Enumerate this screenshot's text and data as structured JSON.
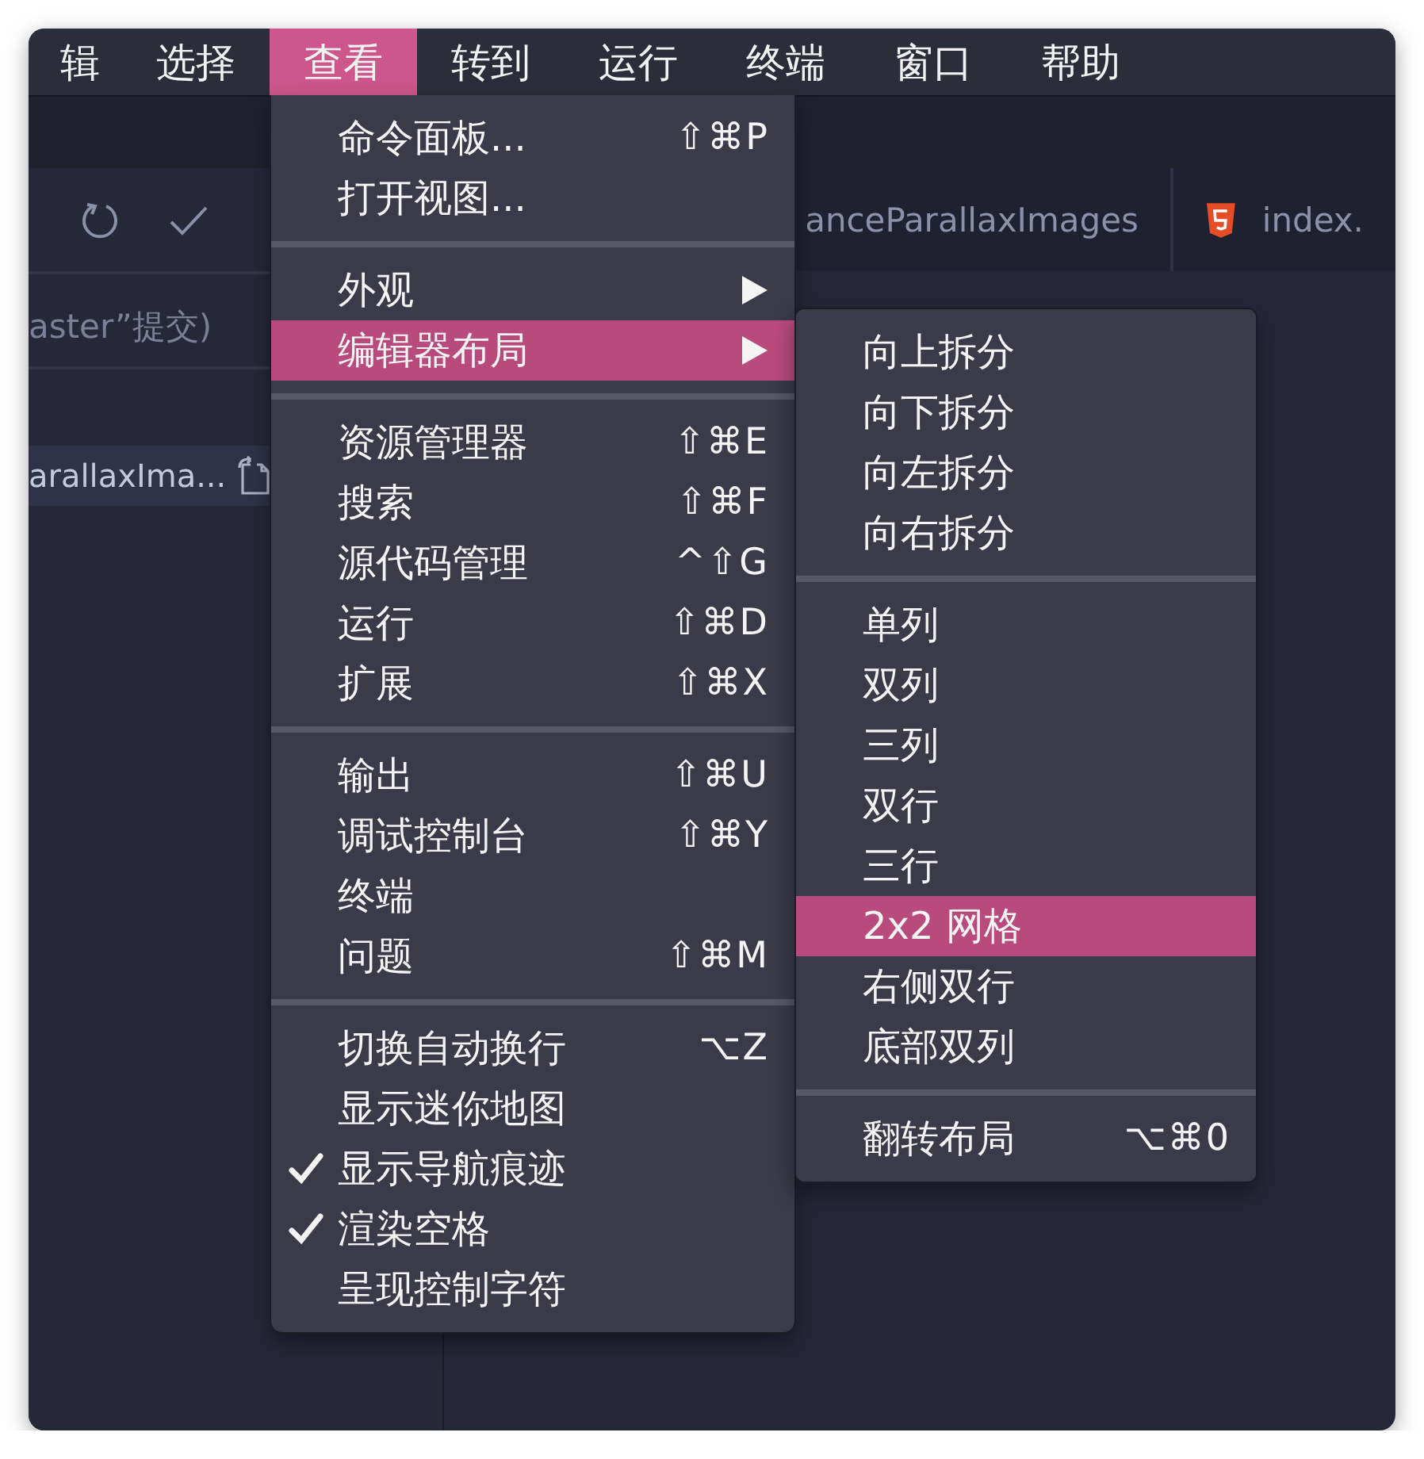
{
  "menubar": [
    {
      "label": "辑",
      "selected": false
    },
    {
      "label": "选择",
      "selected": false
    },
    {
      "label": "查看",
      "selected": true
    },
    {
      "label": "转到",
      "selected": false
    },
    {
      "label": "运行",
      "selected": false
    },
    {
      "label": "终端",
      "selected": false
    },
    {
      "label": "窗口",
      "selected": false
    },
    {
      "label": "帮助",
      "selected": false
    }
  ],
  "sidebar": {
    "commit_placeholder": "aster”提交)",
    "file_row": "arallaxIma..."
  },
  "editor_tabs": [
    {
      "label": "anceParallaxImages"
    },
    {
      "label": "index."
    }
  ],
  "view_menu": {
    "groups": [
      [
        {
          "label": "命令面板...",
          "shortcut": "⇧⌘P",
          "checked": false,
          "submenu": false,
          "selected": false
        },
        {
          "label": "打开视图...",
          "checked": false,
          "submenu": false,
          "selected": false
        }
      ],
      [
        {
          "label": "外观",
          "checked": false,
          "submenu": true,
          "selected": false
        },
        {
          "label": "编辑器布局",
          "checked": false,
          "submenu": true,
          "selected": true
        }
      ],
      [
        {
          "label": "资源管理器",
          "shortcut": "⇧⌘E",
          "checked": false,
          "submenu": false,
          "selected": false
        },
        {
          "label": "搜索",
          "shortcut": "⇧⌘F",
          "checked": false,
          "submenu": false,
          "selected": false
        },
        {
          "label": "源代码管理",
          "shortcut": "^⇧G",
          "checked": false,
          "submenu": false,
          "selected": false
        },
        {
          "label": "运行",
          "shortcut": "⇧⌘D",
          "checked": false,
          "submenu": false,
          "selected": false
        },
        {
          "label": "扩展",
          "shortcut": "⇧⌘X",
          "checked": false,
          "submenu": false,
          "selected": false
        }
      ],
      [
        {
          "label": "输出",
          "shortcut": "⇧⌘U",
          "checked": false,
          "submenu": false,
          "selected": false
        },
        {
          "label": "调试控制台",
          "shortcut": "⇧⌘Y",
          "checked": false,
          "submenu": false,
          "selected": false
        },
        {
          "label": "终端",
          "checked": false,
          "submenu": false,
          "selected": false
        },
        {
          "label": "问题",
          "shortcut": "⇧⌘M",
          "checked": false,
          "submenu": false,
          "selected": false
        }
      ],
      [
        {
          "label": "切换自动换行",
          "shortcut": "⌥Z",
          "checked": false,
          "submenu": false,
          "selected": false
        },
        {
          "label": "显示迷你地图",
          "checked": false,
          "submenu": false,
          "selected": false
        },
        {
          "label": "显示导航痕迹",
          "checked": true,
          "submenu": false,
          "selected": false
        },
        {
          "label": "渲染空格",
          "checked": true,
          "submenu": false,
          "selected": false
        },
        {
          "label": "呈现控制字符",
          "checked": false,
          "submenu": false,
          "selected": false
        }
      ]
    ]
  },
  "layout_submenu": {
    "groups": [
      [
        {
          "label": "向上拆分",
          "selected": false
        },
        {
          "label": "向下拆分",
          "selected": false
        },
        {
          "label": "向左拆分",
          "selected": false
        },
        {
          "label": "向右拆分",
          "selected": false
        }
      ],
      [
        {
          "label": "单列",
          "selected": false
        },
        {
          "label": "双列",
          "selected": false
        },
        {
          "label": "三列",
          "selected": false
        },
        {
          "label": "双行",
          "selected": false
        },
        {
          "label": "三行",
          "selected": false
        },
        {
          "label": "2x2 网格",
          "selected": true
        },
        {
          "label": "右侧双行",
          "selected": false
        },
        {
          "label": "底部双列",
          "selected": false
        }
      ],
      [
        {
          "label": "翻转布局",
          "shortcut": "⌥⌘0",
          "selected": false
        }
      ]
    ]
  }
}
